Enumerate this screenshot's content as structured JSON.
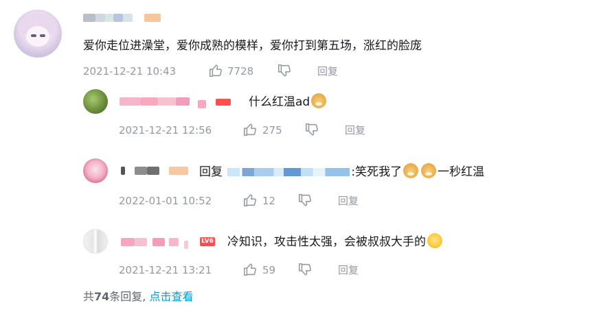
{
  "comment": {
    "text": "爱你走位进澡堂，爱你成熟的模样，爱你打到第五场，涨红的脸庞",
    "timestamp": "2021-12-21 10:43",
    "likes": "7728",
    "reply_label": "回复"
  },
  "replies": [
    {
      "text": "什么红温ad",
      "emoji": "doge",
      "timestamp": "2021-12-21 12:56",
      "likes": "275",
      "reply_label": "回复"
    },
    {
      "reply_prefix": "回复",
      "text_after": ":笑死我了",
      "text_end": "一秒红温",
      "emoji": "doge",
      "timestamp": "2022-01-01 10:52",
      "likes": "12",
      "reply_label": "回复"
    },
    {
      "level_badge": "LV6",
      "text": "冷知识，攻击性太强，会被叔叔大手的",
      "emoji": "smile",
      "timestamp": "2021-12-21 13:21",
      "likes": "59",
      "reply_label": "回复"
    }
  ],
  "footer": {
    "prefix": "共",
    "count": "74",
    "suffix": "条回复, ",
    "view_link": "点击查看"
  },
  "colors": {
    "link": "#00a1d6",
    "meta": "#9499a0",
    "level_badge": "#ff4e4e"
  }
}
